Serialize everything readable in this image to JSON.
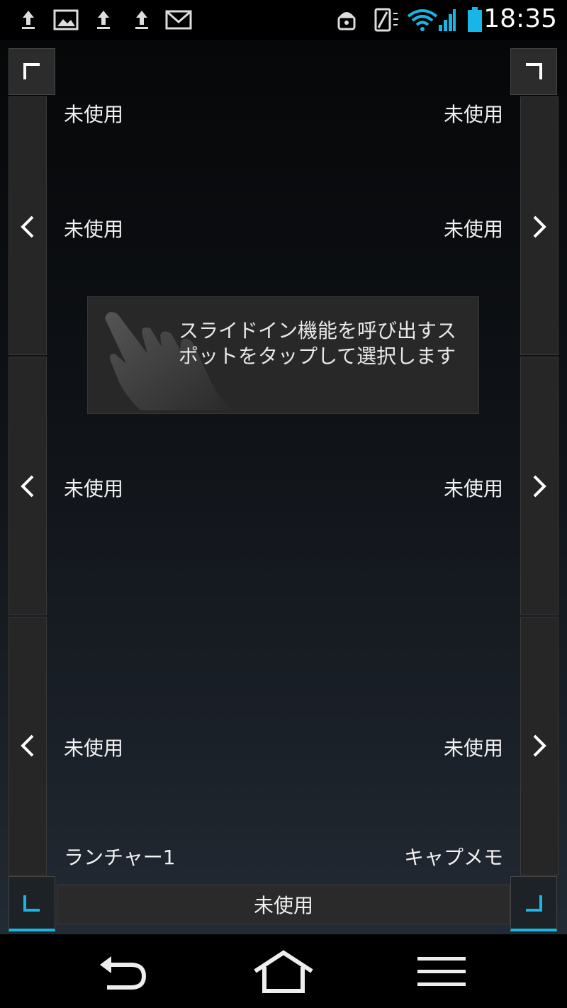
{
  "status_bar": {
    "time": "18:35",
    "left_icons": [
      "upload-icon",
      "image-icon",
      "upload-icon",
      "upload-icon",
      "gmail-icon"
    ],
    "right_icons": [
      "android-lock-icon",
      "phone-vibrate-icon",
      "wifi-icon",
      "signal-icon",
      "battery-icon"
    ],
    "accent_color": "#18b6e6"
  },
  "slots": {
    "left": [
      "未使用",
      "未使用",
      "未使用",
      "未使用"
    ],
    "right": [
      "未使用",
      "未使用",
      "未使用",
      "未使用"
    ],
    "bottom_left": "ランチャー1",
    "bottom_right": "キャプメモ",
    "bottom_center": "未使用"
  },
  "tooltip": {
    "text": "スライドイン機能を呼び出すスポットをタップして選択します"
  },
  "nav": {
    "back": "back-icon",
    "home": "home-icon",
    "menu": "menu-icon"
  }
}
